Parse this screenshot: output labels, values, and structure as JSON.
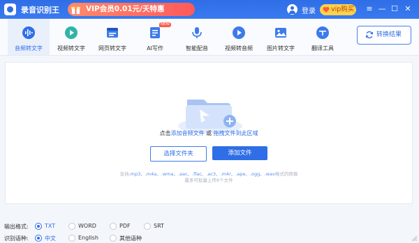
{
  "app": {
    "title": "录音识别王"
  },
  "titlebar": {
    "promo_text": "VIP会员0.01元/天特惠",
    "login": "登录",
    "vip_button": "vip购买",
    "controls": {
      "menu": "≡",
      "minimize": "—",
      "maximize": "☐",
      "close": "✕"
    }
  },
  "tools": [
    {
      "label": "音频转文字",
      "icon": "audio-to-text-icon",
      "active": true
    },
    {
      "label": "视频转文字",
      "icon": "video-to-text-icon"
    },
    {
      "label": "网页转文字",
      "icon": "webpage-to-text-icon"
    },
    {
      "label": "AI写作",
      "icon": "ai-writing-icon",
      "badge": "NEW"
    },
    {
      "label": "智能配音",
      "icon": "smart-dubbing-icon"
    },
    {
      "label": "视频转音频",
      "icon": "video-to-audio-icon"
    },
    {
      "label": "图片转文字",
      "icon": "image-to-text-icon"
    },
    {
      "label": "翻译工具",
      "icon": "translate-icon"
    }
  ],
  "convert_result": "转换结果",
  "drop": {
    "hint_prefix": "点击",
    "hint_add": "添加音频文件",
    "hint_or": " 或 ",
    "hint_drag": "拖拽文件到此区域",
    "choose_folder": "选择文件夹",
    "add_file": "添加文件",
    "formats_prefix": "支持",
    "formats": ".mp3、.m4a、.wma、.aac、.flac、.ac3、.m4r、.ape、.ogg、.wav",
    "formats_suffix": "格式的转换",
    "max_files": "最多可批量上传8个文件"
  },
  "options": {
    "output_label": "输出格式:",
    "output": [
      {
        "label": "TXT",
        "selected": true
      },
      {
        "label": "WORD",
        "selected": false
      },
      {
        "label": "PDF",
        "selected": false
      },
      {
        "label": "SRT",
        "selected": false
      }
    ],
    "lang_label": "识别语种:",
    "langs": [
      {
        "label": "中文",
        "selected": true
      },
      {
        "label": "English",
        "selected": false
      },
      {
        "label": "其他语种",
        "selected": false
      }
    ]
  },
  "colors": {
    "primary": "#2f6ee6",
    "promo": "#ff5a5a",
    "vip": "#ffd24a",
    "new_badge": "#ff5a4a"
  }
}
